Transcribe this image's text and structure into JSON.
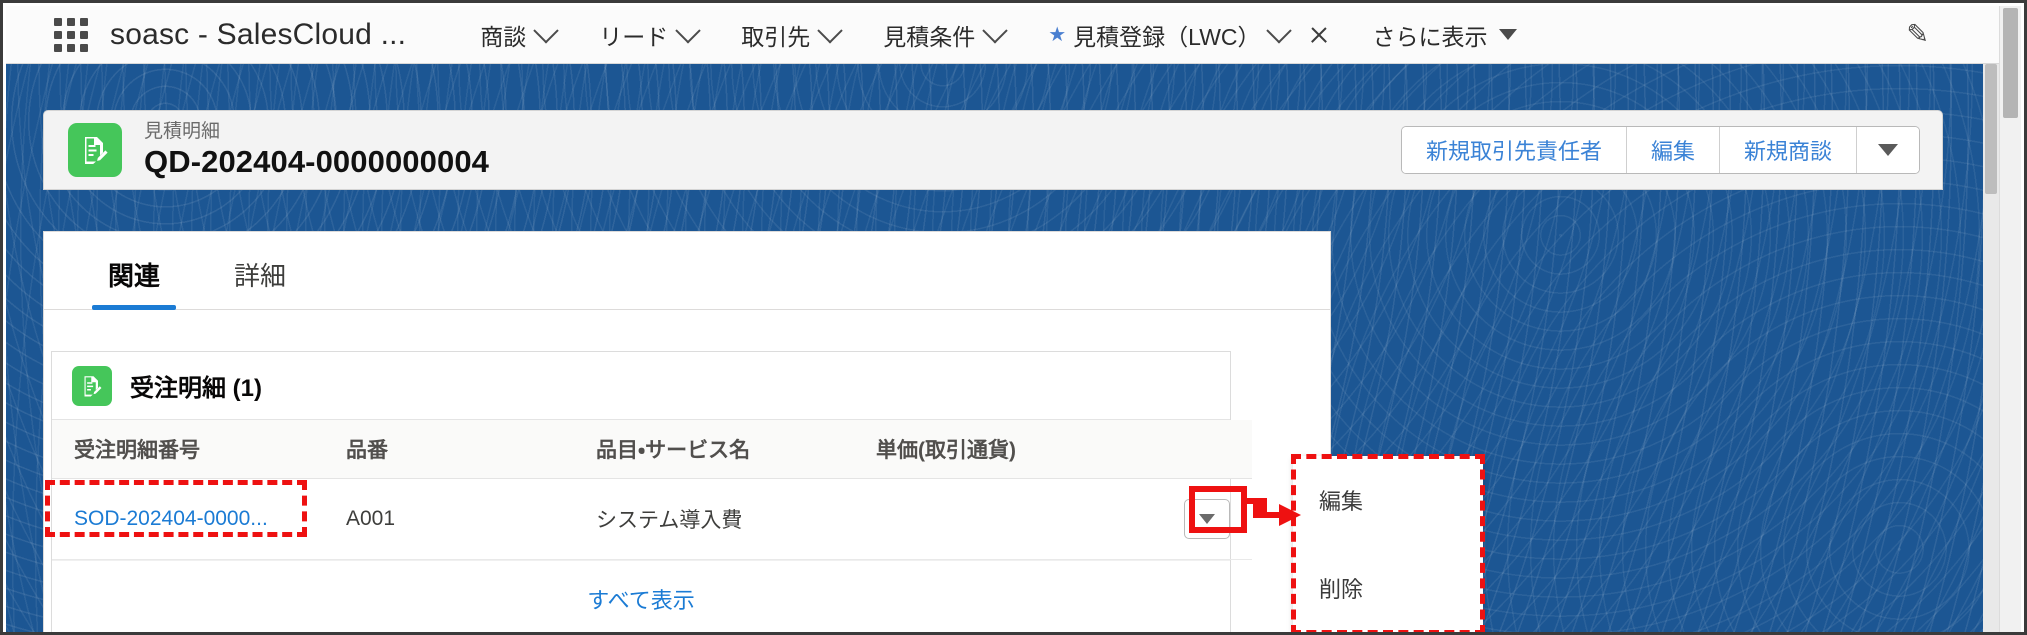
{
  "appbar": {
    "waffle_icon": "app-launcher-grid-icon",
    "app_title": "soasc - SalesCloud ...",
    "nav_items": [
      {
        "label": "商談",
        "has_chevron": true,
        "starred": false,
        "closable": false
      },
      {
        "label": "リード",
        "has_chevron": true,
        "starred": false,
        "closable": false
      },
      {
        "label": "取引先",
        "has_chevron": true,
        "starred": false,
        "closable": false
      },
      {
        "label": "見積条件",
        "has_chevron": true,
        "starred": false,
        "closable": false
      },
      {
        "label": "見積登録（LWC）",
        "has_chevron": true,
        "starred": true,
        "closable": true
      }
    ],
    "more_label": "さらに表示",
    "more_icon": "caret-down-icon",
    "edit_icon": "pencil-icon"
  },
  "record": {
    "icon": "quote-detail-green-icon",
    "object_label": "見積明細",
    "title": "QD-202404-0000000004",
    "actions": [
      {
        "label": "新規取引先責任者"
      },
      {
        "label": "編集"
      },
      {
        "label": "新規商談"
      }
    ],
    "more_actions_icon": "caret-down-icon"
  },
  "tabs": [
    {
      "label": "関連",
      "active": true
    },
    {
      "label": "詳細",
      "active": false
    }
  ],
  "related_list": {
    "icon": "order-detail-green-icon",
    "title": "受注明細 (1)",
    "columns": [
      "受注明細番号",
      "品番",
      "品目・サービス名",
      "単価(取引通貨)"
    ],
    "rows": [
      {
        "number": "SOD-202404-0000...",
        "part_number": "A001",
        "item_name": "システム導入費",
        "unit_price": "",
        "row_menu_icon": "caret-down-icon"
      }
    ],
    "show_all_label": "すべて表示"
  },
  "action_menu": {
    "items": [
      {
        "label": "編集"
      },
      {
        "label": "削除"
      }
    ]
  },
  "annotations": {
    "highlight_color": "#ee1111",
    "arrow_icon": "red-arrow-icon"
  }
}
